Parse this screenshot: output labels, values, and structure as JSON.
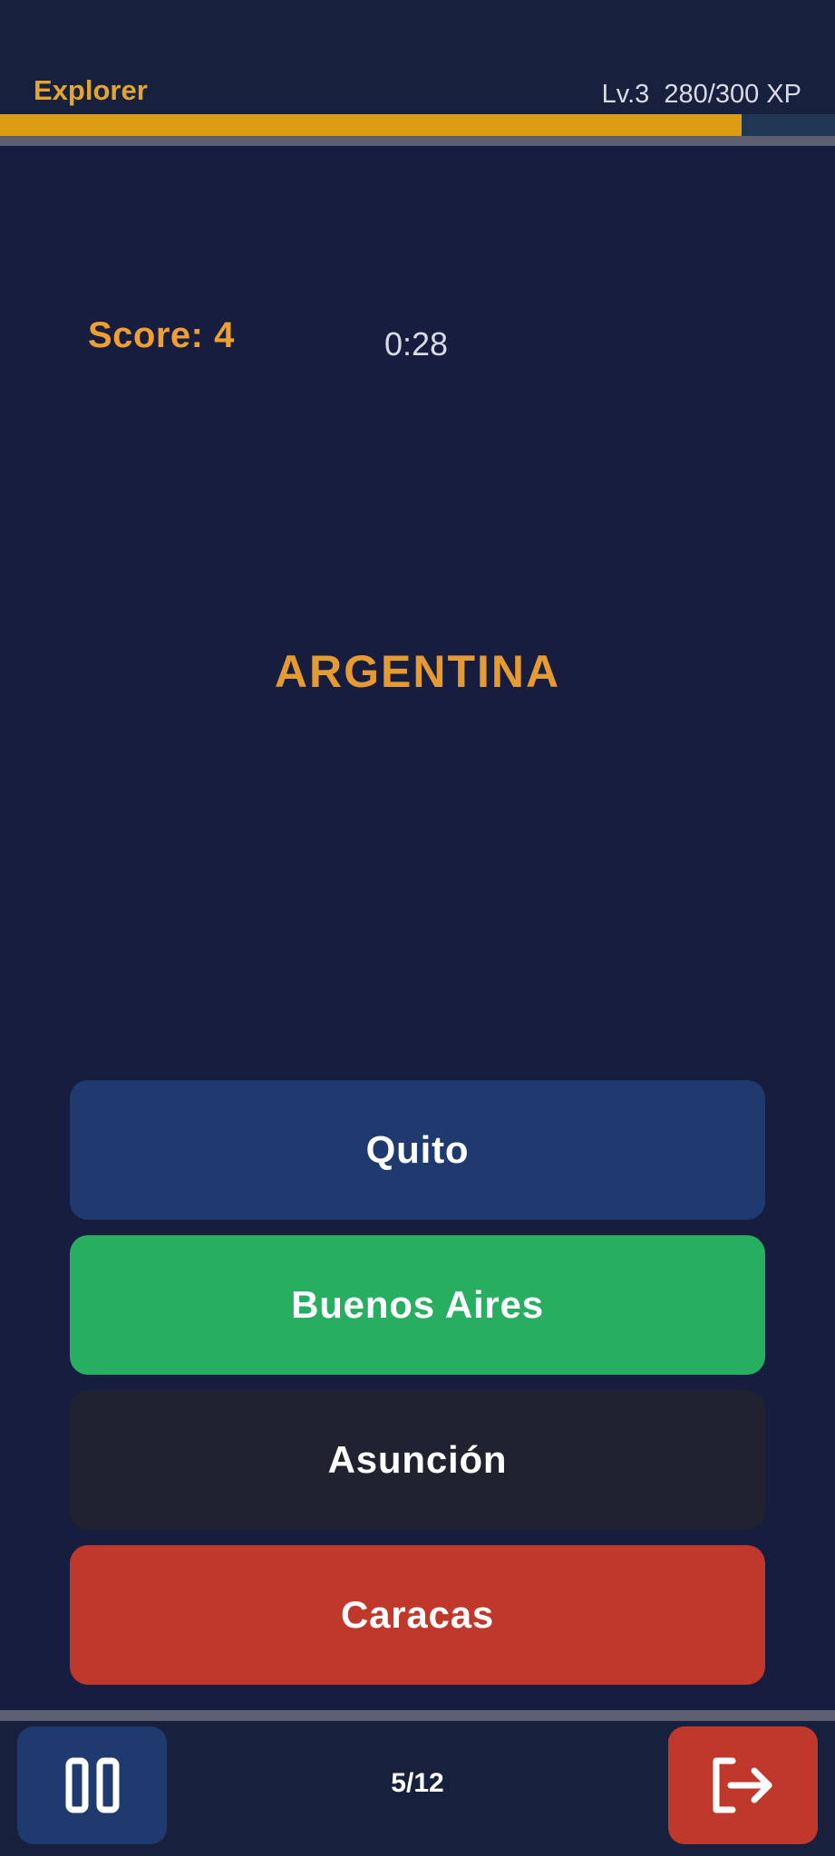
{
  "header": {
    "rank_title": "Explorer",
    "level_xp": "Lv.3  280/300 XP",
    "xp_current": 280,
    "xp_max": 300
  },
  "game": {
    "score_label": "Score: 4",
    "timer": "0:28",
    "country": "ARGENTINA"
  },
  "answers": [
    {
      "label": "Quito",
      "color": "#1e3a6e"
    },
    {
      "label": "Buenos Aires",
      "color": "#27ae60"
    },
    {
      "label": "Asunción",
      "color": "#21222f"
    },
    {
      "label": "Caracas",
      "color": "#c0382b"
    }
  ],
  "footer": {
    "progress": "5/12",
    "pause_icon": "pause-icon",
    "exit_icon": "exit-icon"
  },
  "colors": {
    "background": "#161d3f",
    "accent": "#e3a531",
    "xp_fill": "#db9d12"
  }
}
